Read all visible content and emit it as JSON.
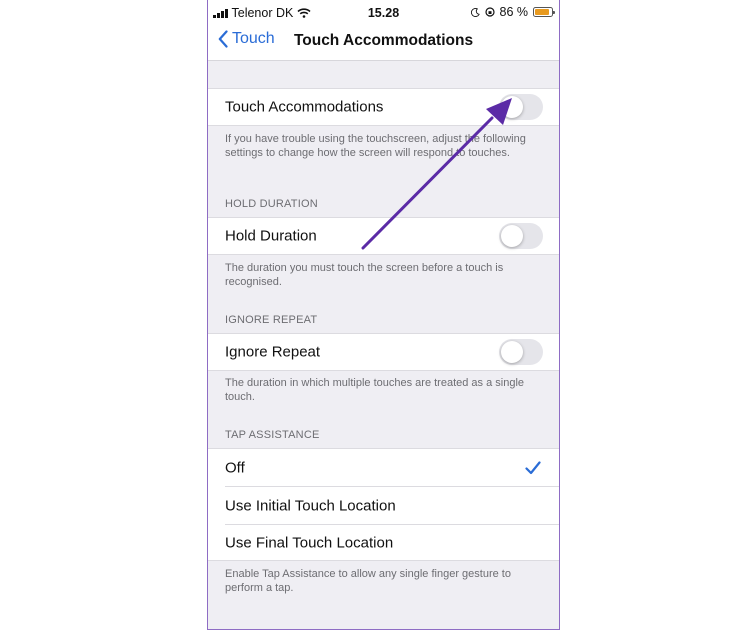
{
  "status": {
    "carrier": "Telenor DK",
    "time": "15.28",
    "battery": "86 %",
    "battery_color": "#e89a1f"
  },
  "nav": {
    "back_label": "Touch",
    "title": "Touch Accommodations"
  },
  "touch_accommodations": {
    "label": "Touch Accommodations",
    "enabled": false,
    "footer": "If you have trouble using the touchscreen, adjust the following settings to change how the screen will respond to touches."
  },
  "hold_duration": {
    "header": "HOLD DURATION",
    "label": "Hold Duration",
    "enabled": false,
    "footer": "The duration you must touch the screen before a touch is recognised."
  },
  "ignore_repeat": {
    "header": "IGNORE REPEAT",
    "label": "Ignore Repeat",
    "enabled": false,
    "footer": "The duration in which multiple touches are treated as a single touch."
  },
  "tap_assistance": {
    "header": "TAP ASSISTANCE",
    "options": [
      {
        "label": "Off",
        "selected": true
      },
      {
        "label": "Use Initial Touch Location",
        "selected": false
      },
      {
        "label": "Use Final Touch Location",
        "selected": false
      }
    ],
    "footer": "Enable Tap Assistance to allow any single finger gesture to perform a tap."
  },
  "colors": {
    "accent": "#2a6cd6",
    "annotation_arrow": "#5b2ba6",
    "frame_border": "#8e6cc4"
  },
  "icons": [
    "signal-icon",
    "wifi-icon",
    "moon-icon",
    "rotation-lock-icon",
    "battery-icon",
    "chevron-left-icon",
    "checkmark-icon",
    "annotation-arrow"
  ]
}
